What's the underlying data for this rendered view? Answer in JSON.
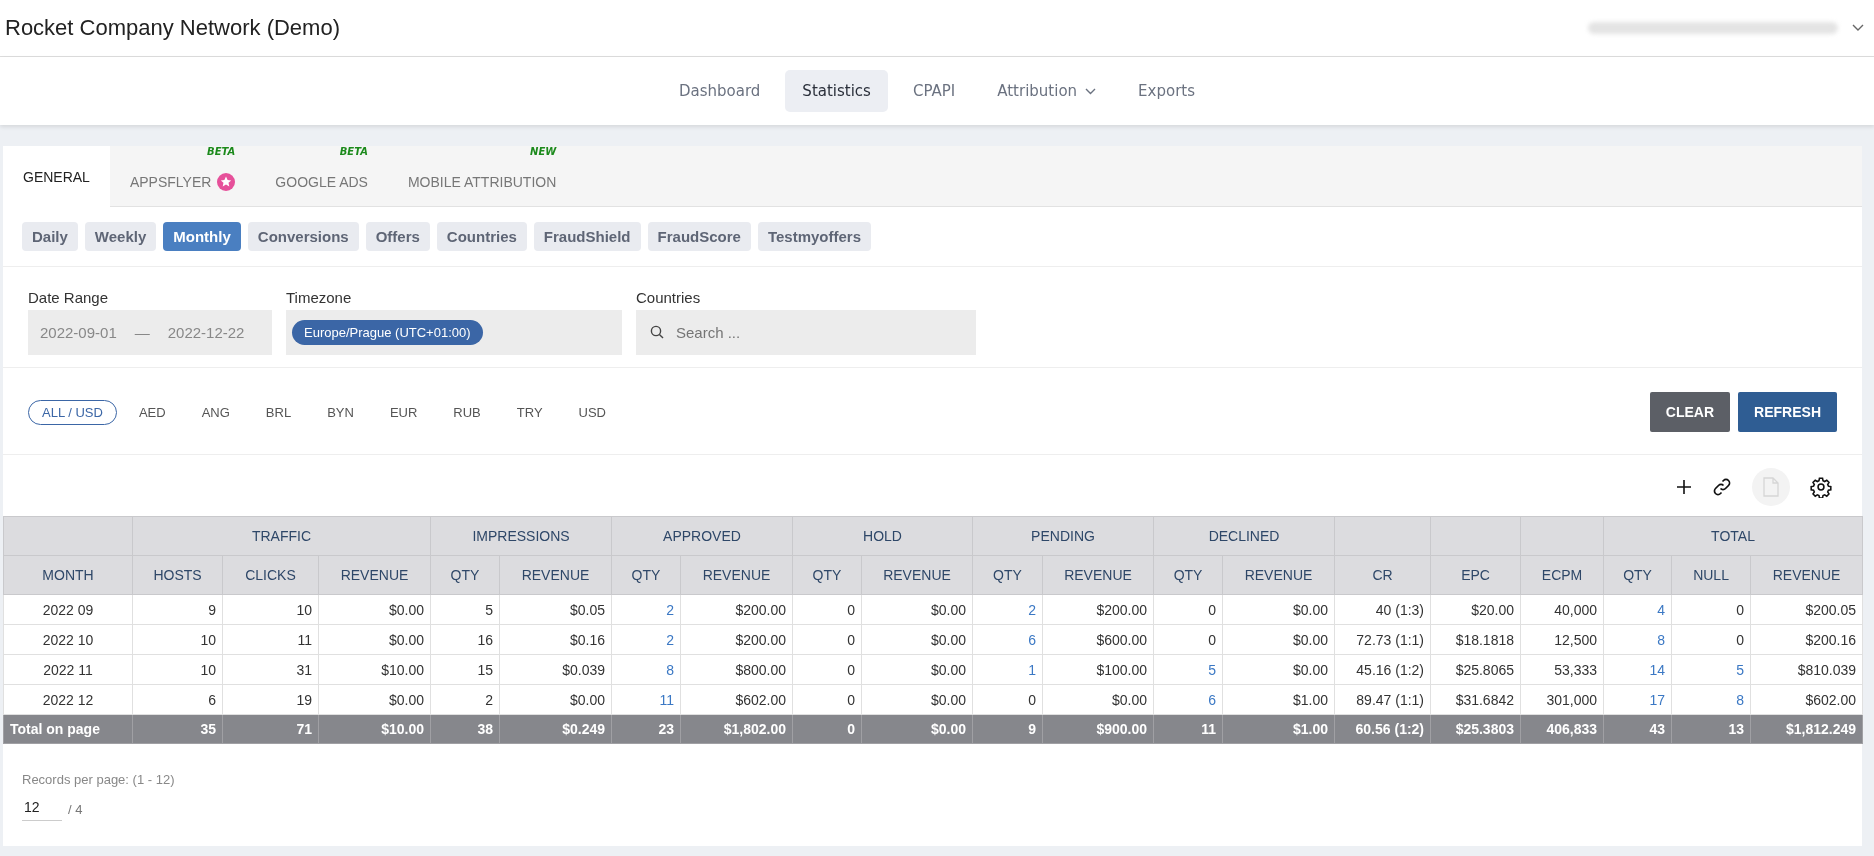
{
  "header": {
    "title": "Rocket Company Network (Demo)"
  },
  "nav": [
    {
      "label": "Dashboard",
      "selected": false,
      "has_menu": false
    },
    {
      "label": "Statistics",
      "selected": true,
      "has_menu": false
    },
    {
      "label": "CPAPI",
      "selected": false,
      "has_menu": false
    },
    {
      "label": "Attribution",
      "selected": false,
      "has_menu": true
    },
    {
      "label": "Exports",
      "selected": false,
      "has_menu": false
    }
  ],
  "tabs": [
    {
      "label": "GENERAL",
      "selected": true
    },
    {
      "label": "APPSFLYER",
      "selected": false,
      "badge": "BETA",
      "star": true
    },
    {
      "label": "GOOGLE ADS",
      "selected": false,
      "badge": "BETA"
    },
    {
      "label": "MOBILE ATTRIBUTION",
      "selected": false,
      "badge": "NEW"
    }
  ],
  "subtabs": [
    {
      "label": "Daily",
      "selected": false
    },
    {
      "label": "Weekly",
      "selected": false
    },
    {
      "label": "Monthly",
      "selected": true
    },
    {
      "label": "Conversions",
      "selected": false
    },
    {
      "label": "Offers",
      "selected": false
    },
    {
      "label": "Countries",
      "selected": false
    },
    {
      "label": "FraudShield",
      "selected": false
    },
    {
      "label": "FraudScore",
      "selected": false
    },
    {
      "label": "Testmyoffers",
      "selected": false
    }
  ],
  "filters": {
    "date_range": {
      "label": "Date Range",
      "from": "2022-09-01",
      "separator": "—",
      "to": "2022-12-22"
    },
    "timezone": {
      "label": "Timezone",
      "value": "Europe/Prague (UTC+01:00)"
    },
    "countries": {
      "label": "Countries",
      "placeholder": "Search ..."
    }
  },
  "currencies": [
    {
      "label": "ALL / USD",
      "selected": true
    },
    {
      "label": "AED",
      "selected": false
    },
    {
      "label": "ANG",
      "selected": false
    },
    {
      "label": "BRL",
      "selected": false
    },
    {
      "label": "BYN",
      "selected": false
    },
    {
      "label": "EUR",
      "selected": false
    },
    {
      "label": "RUB",
      "selected": false
    },
    {
      "label": "TRY",
      "selected": false
    },
    {
      "label": "USD",
      "selected": false
    }
  ],
  "actions": [
    "CLEAR",
    "REFRESH"
  ],
  "table": {
    "groups": [
      {
        "columns": [
          "MONTH"
        ]
      },
      {
        "label": "TRAFFIC",
        "columns": [
          "HOSTS",
          "CLICKS",
          "REVENUE"
        ]
      },
      {
        "label": "IMPRESSIONS",
        "columns": [
          "QTY",
          "REVENUE"
        ]
      },
      {
        "label": "APPROVED",
        "columns": [
          "QTY",
          "REVENUE"
        ]
      },
      {
        "label": "HOLD",
        "columns": [
          "QTY",
          "REVENUE"
        ]
      },
      {
        "label": "PENDING",
        "columns": [
          "QTY",
          "REVENUE"
        ]
      },
      {
        "label": "DECLINED",
        "columns": [
          "QTY",
          "REVENUE"
        ]
      },
      {
        "columns": [
          "CR"
        ]
      },
      {
        "columns": [
          "EPC"
        ]
      },
      {
        "columns": [
          "ECPM"
        ]
      },
      {
        "label": "TOTAL",
        "columns": [
          "QTY",
          "NULL",
          "REVENUE"
        ]
      }
    ],
    "rows": [
      {
        "cells": [
          {
            "text": "2022 09",
            "link": false
          },
          {
            "text": "9",
            "link": false
          },
          {
            "text": "10",
            "link": false
          },
          {
            "text": "$0.00",
            "link": false
          },
          {
            "text": "5",
            "link": false
          },
          {
            "text": "$0.05",
            "link": false
          },
          {
            "text": "2",
            "link": true
          },
          {
            "text": "$200.00",
            "link": false
          },
          {
            "text": "0",
            "link": false
          },
          {
            "text": "$0.00",
            "link": false
          },
          {
            "text": "2",
            "link": true
          },
          {
            "text": "$200.00",
            "link": false
          },
          {
            "text": "0",
            "link": false
          },
          {
            "text": "$0.00",
            "link": false
          },
          {
            "text": "40 (1:3)",
            "link": false
          },
          {
            "text": "$20.00",
            "link": false
          },
          {
            "text": "40,000",
            "link": false
          },
          {
            "text": "4",
            "link": true
          },
          {
            "text": "0",
            "link": false
          },
          {
            "text": "$200.05",
            "link": false
          }
        ]
      },
      {
        "cells": [
          {
            "text": "2022 10",
            "link": false
          },
          {
            "text": "10",
            "link": false
          },
          {
            "text": "11",
            "link": false
          },
          {
            "text": "$0.00",
            "link": false
          },
          {
            "text": "16",
            "link": false
          },
          {
            "text": "$0.16",
            "link": false
          },
          {
            "text": "2",
            "link": true
          },
          {
            "text": "$200.00",
            "link": false
          },
          {
            "text": "0",
            "link": false
          },
          {
            "text": "$0.00",
            "link": false
          },
          {
            "text": "6",
            "link": true
          },
          {
            "text": "$600.00",
            "link": false
          },
          {
            "text": "0",
            "link": false
          },
          {
            "text": "$0.00",
            "link": false
          },
          {
            "text": "72.73 (1:1)",
            "link": false
          },
          {
            "text": "$18.1818",
            "link": false
          },
          {
            "text": "12,500",
            "link": false
          },
          {
            "text": "8",
            "link": true
          },
          {
            "text": "0",
            "link": false
          },
          {
            "text": "$200.16",
            "link": false
          }
        ]
      },
      {
        "cells": [
          {
            "text": "2022 11",
            "link": false
          },
          {
            "text": "10",
            "link": false
          },
          {
            "text": "31",
            "link": false
          },
          {
            "text": "$10.00",
            "link": false
          },
          {
            "text": "15",
            "link": false
          },
          {
            "text": "$0.039",
            "link": false
          },
          {
            "text": "8",
            "link": true
          },
          {
            "text": "$800.00",
            "link": false
          },
          {
            "text": "0",
            "link": false
          },
          {
            "text": "$0.00",
            "link": false
          },
          {
            "text": "1",
            "link": true
          },
          {
            "text": "$100.00",
            "link": false
          },
          {
            "text": "5",
            "link": true
          },
          {
            "text": "$0.00",
            "link": false
          },
          {
            "text": "45.16 (1:2)",
            "link": false
          },
          {
            "text": "$25.8065",
            "link": false
          },
          {
            "text": "53,333",
            "link": false
          },
          {
            "text": "14",
            "link": true
          },
          {
            "text": "5",
            "link": true
          },
          {
            "text": "$810.039",
            "link": false
          }
        ]
      },
      {
        "cells": [
          {
            "text": "2022 12",
            "link": false
          },
          {
            "text": "6",
            "link": false
          },
          {
            "text": "19",
            "link": false
          },
          {
            "text": "$0.00",
            "link": false
          },
          {
            "text": "2",
            "link": false
          },
          {
            "text": "$0.00",
            "link": false
          },
          {
            "text": "11",
            "link": true
          },
          {
            "text": "$602.00",
            "link": false
          },
          {
            "text": "0",
            "link": false
          },
          {
            "text": "$0.00",
            "link": false
          },
          {
            "text": "0",
            "link": false
          },
          {
            "text": "$0.00",
            "link": false
          },
          {
            "text": "6",
            "link": true
          },
          {
            "text": "$1.00",
            "link": false
          },
          {
            "text": "89.47 (1:1)",
            "link": false
          },
          {
            "text": "$31.6842",
            "link": false
          },
          {
            "text": "301,000",
            "link": false
          },
          {
            "text": "17",
            "link": true
          },
          {
            "text": "8",
            "link": true
          },
          {
            "text": "$602.00",
            "link": false
          }
        ]
      }
    ],
    "total": [
      "Total on page",
      "35",
      "71",
      "$10.00",
      "38",
      "$0.249",
      "23",
      "$1,802.00",
      "0",
      "$0.00",
      "9",
      "$900.00",
      "11",
      "$1.00",
      "60.56 (1:2)",
      "$25.3803",
      "406,833",
      "43",
      "13",
      "$1,812.249"
    ]
  },
  "pagination": {
    "label": "Records per page: (1 - 12)",
    "per_page": "12",
    "pages": "/ 4"
  }
}
